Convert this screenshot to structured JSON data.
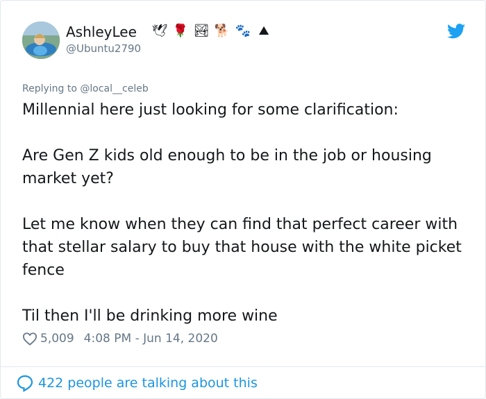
{
  "author": {
    "name": "AshleyLee",
    "handle": "@Ubuntu2790",
    "name_emojis": [
      "🕊",
      "🌹",
      "🏞",
      "🐕",
      "🐾",
      "⛰"
    ]
  },
  "reply": {
    "prefix": "Replying to ",
    "mention": "@local__celeb"
  },
  "tweet": {
    "paragraphs": [
      "Millennial here just looking for some clarification:",
      "Are Gen Z kids old enough to be in the job or housing market yet?",
      "Let me know when they can find that perfect career with that stellar salary to buy that house with the white picket fence",
      "Til then I'll be drinking more wine"
    ]
  },
  "meta": {
    "likes": "5,009",
    "timestamp": "4:08 PM - Jun 14, 2020"
  },
  "footer": {
    "talking_text": "422 people are talking about this"
  },
  "icons": {
    "brand": "twitter-bird-icon",
    "like": "heart-icon",
    "conversation": "speech-bubble-icon"
  },
  "colors": {
    "brand_blue": "#1da1f2",
    "link_blue": "#1b95e0",
    "secondary_text": "#657786",
    "primary_text": "#14171a"
  }
}
